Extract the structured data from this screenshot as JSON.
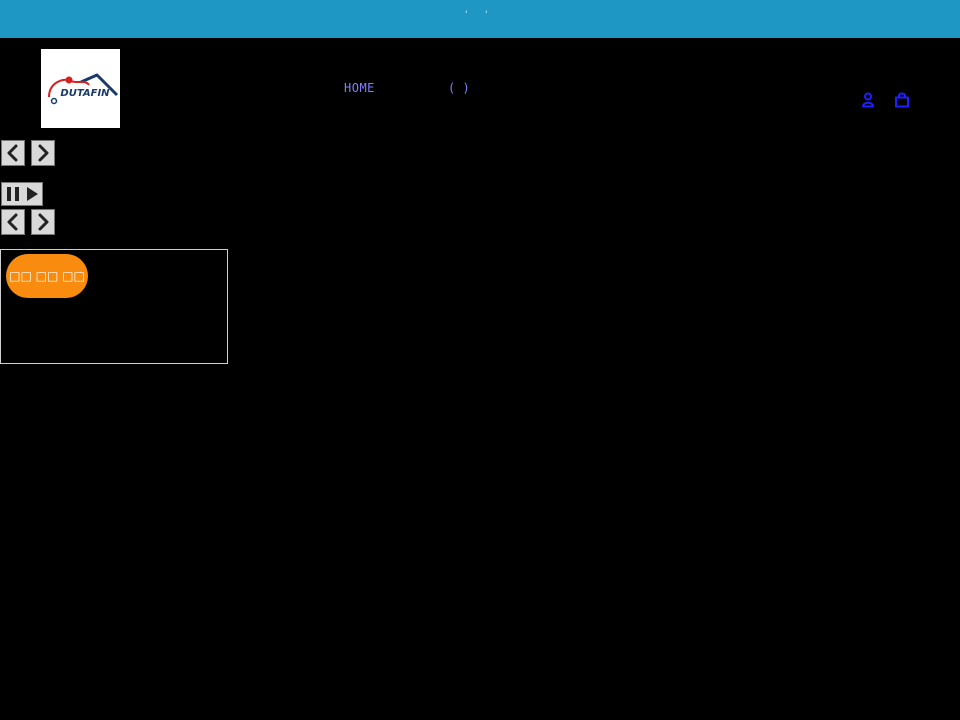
{
  "announcement": {
    "left_mark": "'",
    "right_mark": "'"
  },
  "header": {
    "logo_text": "DUTAFIN",
    "nav": {
      "home_label": "HOME",
      "other_label": "( )"
    },
    "icons": {
      "account": "account-icon",
      "cart": "cart-icon"
    }
  },
  "slider": {
    "prev_icon": "chevron-left-icon",
    "next_icon": "chevron-right-icon",
    "pause_icon": "pause-icon",
    "play_icon": "play-icon"
  },
  "card": {
    "badge_label": "□□ □□ □□"
  },
  "colors": {
    "announcement_bg": "#1e97c4",
    "page_bg": "#000000",
    "nav_link": "#7f7fff",
    "icon_blue": "#1f1fff",
    "badge_bg": "#f98c0e"
  }
}
